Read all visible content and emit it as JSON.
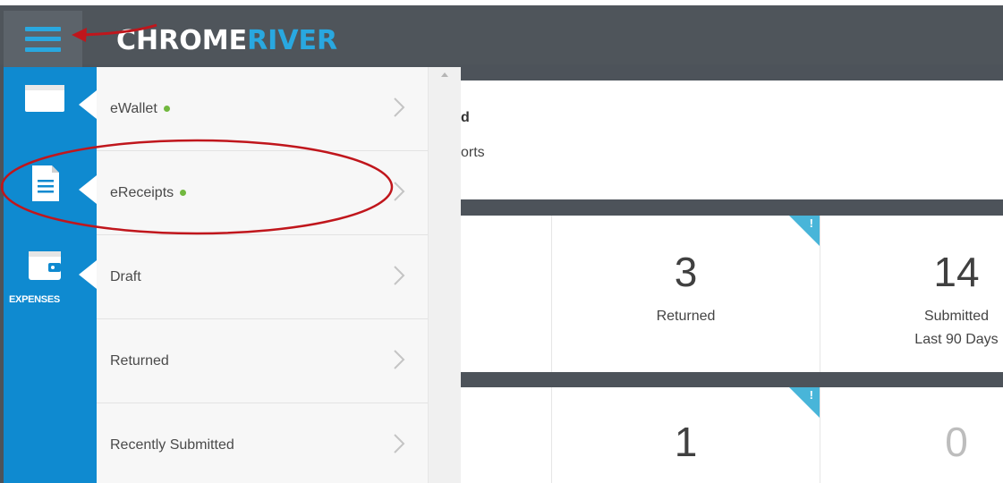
{
  "header": {
    "logo_part1": "CHROME",
    "logo_part2": "RIVER",
    "menu_icon": "hamburger-icon"
  },
  "rail": {
    "items": [
      {
        "icon": "wallet-card-icon"
      },
      {
        "icon": "receipt-document-icon"
      },
      {
        "icon": "expenses-wallet-icon",
        "label": "EXPENSES"
      }
    ]
  },
  "menu": {
    "items": [
      {
        "label": "eWallet",
        "has_dot": true
      },
      {
        "label": "eReceipts",
        "has_dot": true
      },
      {
        "label": "Draft",
        "has_dot": false
      },
      {
        "label": "Returned",
        "has_dot": false
      },
      {
        "label": "Recently Submitted",
        "has_dot": false
      }
    ]
  },
  "main": {
    "top_card": {
      "line1": "d",
      "line2": "orts"
    },
    "row1": [
      {
        "number": "3",
        "label": "Returned"
      },
      {
        "number": "14",
        "label": "Submitted",
        "sublabel": "Last 90 Days"
      }
    ],
    "row2": [
      {
        "number": "1"
      },
      {
        "number": "0"
      }
    ],
    "flag_glyph": "!"
  },
  "colors": {
    "brand_blue": "#0f8ad0",
    "accent_blue": "#29a8e0",
    "topbar": "#4f555b",
    "annotation_red": "#c0161c",
    "status_green": "#72b83f"
  }
}
